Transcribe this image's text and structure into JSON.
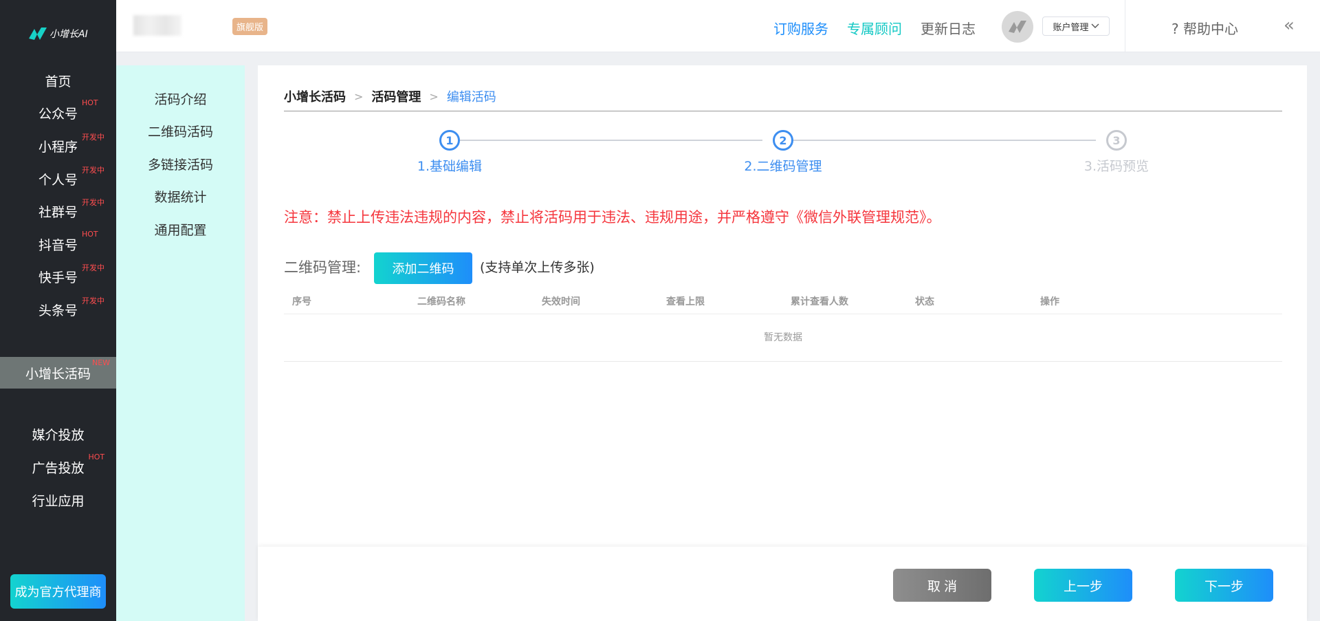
{
  "logo": {
    "text": "小增长AI"
  },
  "sidebar": {
    "items": [
      {
        "label": "首页",
        "tag": ""
      },
      {
        "label": "公众号",
        "tag": "HOT"
      },
      {
        "label": "小程序",
        "tag": "开发中"
      },
      {
        "label": "个人号",
        "tag": "开发中"
      },
      {
        "label": "社群号",
        "tag": "开发中"
      },
      {
        "label": "抖音号",
        "tag": "HOT"
      },
      {
        "label": "快手号",
        "tag": "开发中"
      },
      {
        "label": "头条号",
        "tag": "开发中"
      },
      {
        "label": "小增长活码",
        "tag": "NEW"
      },
      {
        "label": "媒介投放",
        "tag": ""
      },
      {
        "label": "广告投放",
        "tag": "HOT"
      },
      {
        "label": "行业应用",
        "tag": ""
      }
    ],
    "agent_button": "成为官方代理商"
  },
  "header": {
    "edition": "旗舰版",
    "subscribe": "订购服务",
    "advisor": "专属顾问",
    "changelog": "更新日志",
    "account": "账户管理",
    "help": "帮助中心",
    "colors": {
      "subscribe": "#1e8efa",
      "advisor": "#13c8c4",
      "changelog": "#666666"
    }
  },
  "subnav": {
    "items": [
      "活码介绍",
      "二维码活码",
      "多链接活码",
      "数据统计",
      "通用配置"
    ]
  },
  "breadcrumb": [
    "小增长活码",
    "活码管理",
    "编辑活码"
  ],
  "steps": [
    {
      "num": "1",
      "label": "1.基础编辑",
      "state": "done"
    },
    {
      "num": "2",
      "label": "2.二维码管理",
      "state": "active"
    },
    {
      "num": "3",
      "label": "3.活码预览",
      "state": "todo"
    }
  ],
  "notice": "注意：禁止上传违法违规的内容，禁止将活码用于违法、违规用途，并严格遵守《微信外联管理规范》。",
  "qr": {
    "label": "二维码管理:",
    "add_button": "添加二维码",
    "hint": "(支持单次上传多张)",
    "columns": [
      "序号",
      "二维码名称",
      "失效时间",
      "查看上限",
      "累计查看人数",
      "状态",
      "操作"
    ],
    "empty_text": "暂无数据"
  },
  "footer": {
    "cancel": "取 消",
    "prev": "上一步",
    "next": "下一步"
  }
}
